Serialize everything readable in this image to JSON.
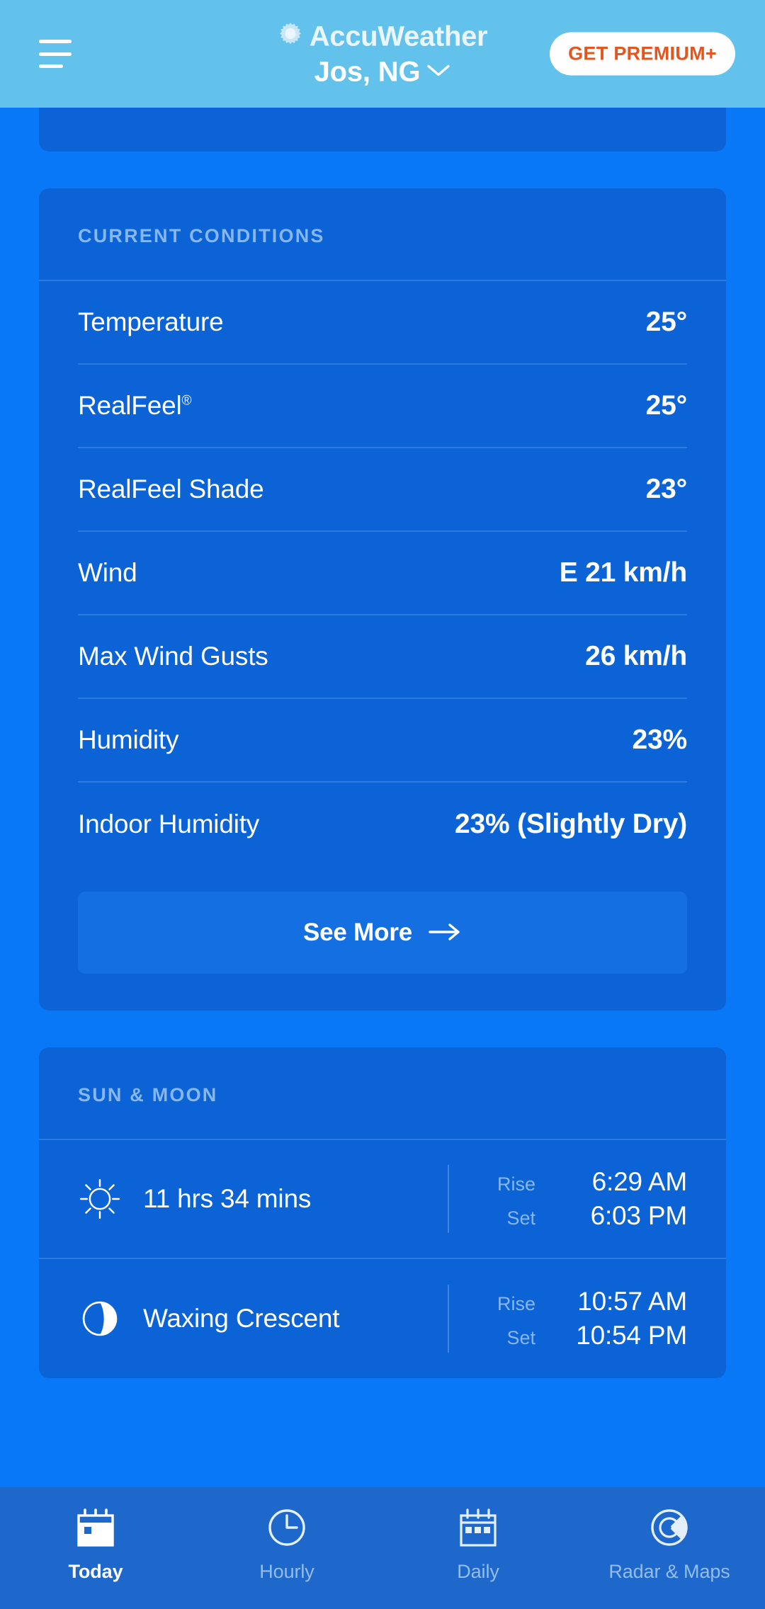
{
  "header": {
    "menu_icon": "hamburger-menu-icon",
    "logo_icon": "accuweather-sun-icon",
    "brand": "AccuWeather",
    "location": "Jos, NG",
    "location_chevron_icon": "chevron-down-icon",
    "premium_label": "GET PREMIUM+",
    "bg_color": "#63C2EC",
    "premium_text_color": "#E2561F"
  },
  "page": {
    "bg_color": "#0878F7",
    "card_color": "#0B63D6"
  },
  "current_conditions": {
    "title": "CURRENT CONDITIONS",
    "rows": [
      {
        "label": "Temperature",
        "value": "25°"
      },
      {
        "label": "RealFeel",
        "value": "25°",
        "sup": "®"
      },
      {
        "label": "RealFeel Shade",
        "value": "23°"
      },
      {
        "label": "Wind",
        "value": "E 21 km/h"
      },
      {
        "label": "Max Wind Gusts",
        "value": "26 km/h"
      },
      {
        "label": "Humidity",
        "value": "23%"
      },
      {
        "label": "Indoor Humidity",
        "value": "23% (Slightly Dry)"
      }
    ],
    "see_more_label": "See More",
    "see_more_icon": "arrow-right-icon"
  },
  "sun_and_moon": {
    "title": "SUN & MOON",
    "sun": {
      "icon": "sun-icon",
      "duration": "11 hrs 34 mins",
      "rise_key": "Rise",
      "rise_value": "6:29 AM",
      "set_key": "Set",
      "set_value": "6:03 PM"
    },
    "moon": {
      "icon": "moon-waxing-crescent-icon",
      "phase": "Waxing Crescent",
      "rise_key": "Rise",
      "rise_value": "10:57 AM",
      "set_key": "Set",
      "set_value": "10:54 PM"
    }
  },
  "bottom_nav": {
    "bg_color": "#1E68CC",
    "items": [
      {
        "label": "Today",
        "icon": "calendar-today-icon",
        "active": true
      },
      {
        "label": "Hourly",
        "icon": "clock-icon",
        "active": false
      },
      {
        "label": "Daily",
        "icon": "calendar-daily-icon",
        "active": false
      },
      {
        "label": "Radar & Maps",
        "icon": "radar-icon",
        "active": false
      }
    ]
  }
}
